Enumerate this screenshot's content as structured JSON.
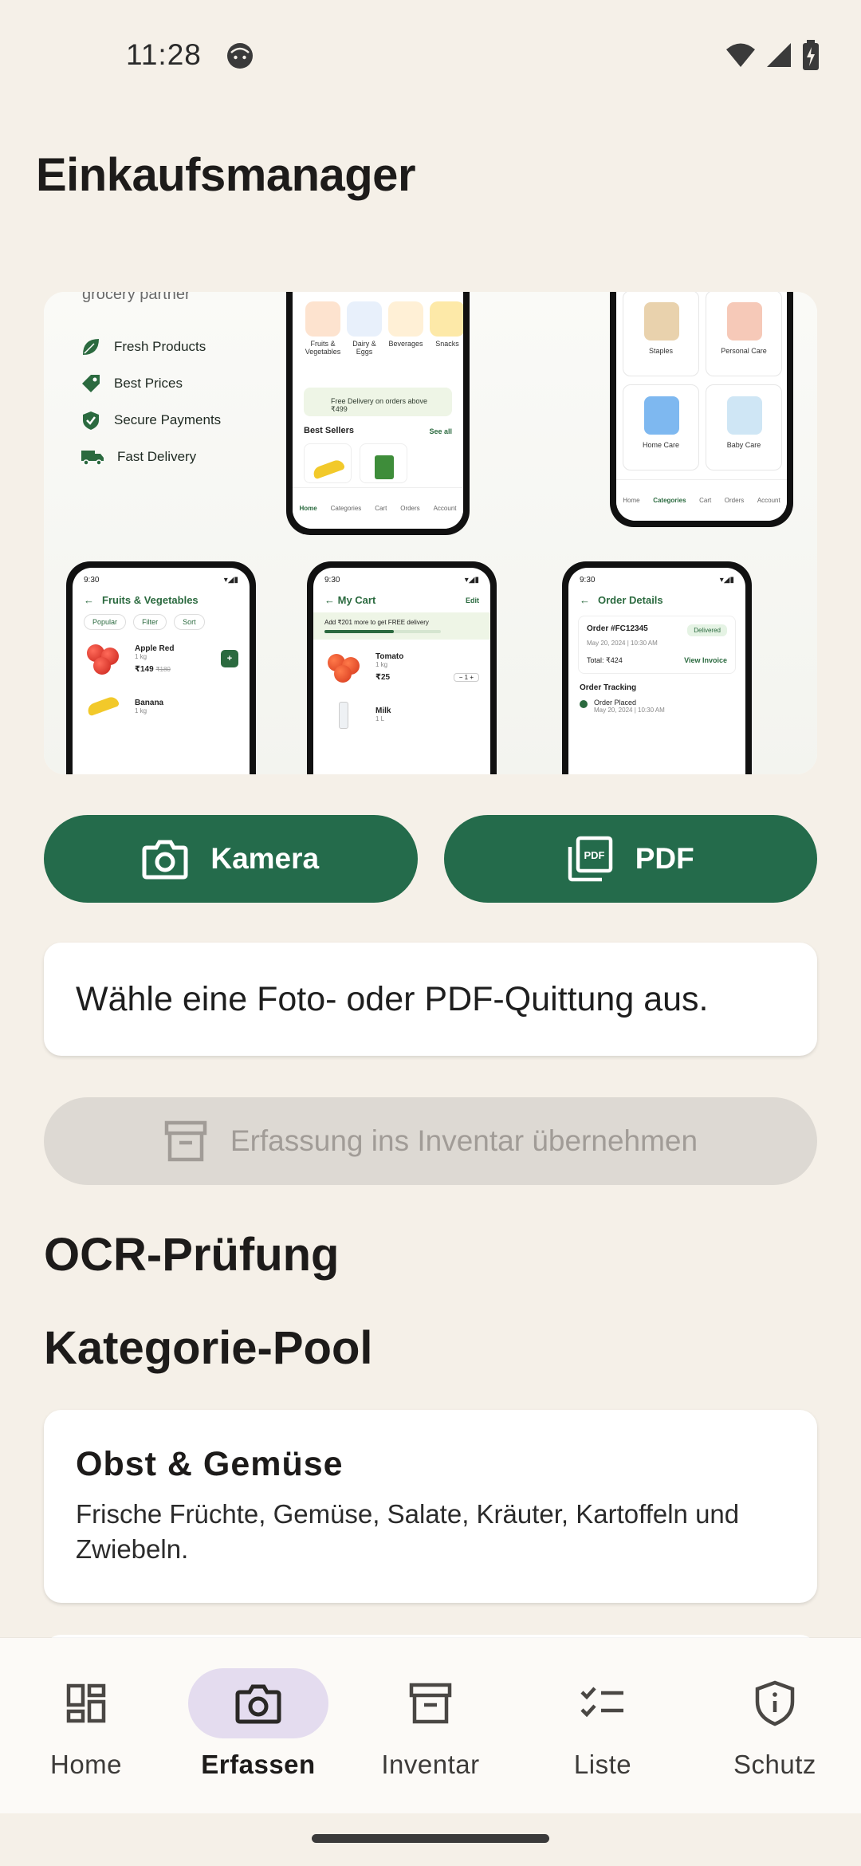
{
  "status": {
    "time": "11:28"
  },
  "app": {
    "title": "Einkaufsmanager"
  },
  "hero": {
    "partner_text": "grocery partner",
    "features": [
      "Fresh Products",
      "Best Prices",
      "Secure Payments",
      "Fast Delivery"
    ],
    "home_screen": {
      "categories": [
        "Fruits & Vegetables",
        "Dairy & Eggs",
        "Beverages",
        "Snacks"
      ],
      "promo": "Free Delivery on orders above ₹499",
      "best_sellers": "Best Sellers",
      "see_all": "See all",
      "nav": [
        "Home",
        "Categories",
        "Cart",
        "Orders",
        "Account"
      ]
    },
    "categories_screen": {
      "tiles": [
        "Staples",
        "Personal Care",
        "Home Care",
        "Baby Care"
      ],
      "nav": [
        "Home",
        "Categories",
        "Cart",
        "Orders",
        "Account"
      ]
    },
    "fruits_screen": {
      "time": "9:30",
      "title": "Fruits & Vegetables",
      "chips": [
        "Popular",
        "Filter",
        "Sort"
      ],
      "items": [
        {
          "name": "Apple Red",
          "qty": "1 kg",
          "price": "₹149",
          "old_price": "₹180"
        },
        {
          "name": "Banana",
          "qty": "1 kg"
        }
      ]
    },
    "cart_screen": {
      "time": "9:30",
      "title": "My Cart",
      "edit": "Edit",
      "promo": "Add ₹201 more to get FREE delivery",
      "items": [
        {
          "name": "Tomato",
          "qty": "1 kg",
          "price": "₹25",
          "count": "1"
        },
        {
          "name": "Milk",
          "qty": "1 L"
        }
      ]
    },
    "order_screen": {
      "time": "9:30",
      "title": "Order Details",
      "order_id": "Order #FC12345",
      "status": "Delivered",
      "date": "May 20, 2024 | 10:30 AM",
      "total": "Total: ₹424",
      "view_invoice": "View Invoice",
      "tracking": "Order Tracking",
      "placed": "Order Placed",
      "placed_date": "May 20, 2024 | 10:30 AM"
    }
  },
  "actions": {
    "camera_label": "Kamera",
    "pdf_label": "PDF",
    "info_text": "Wähle eine Foto- oder PDF-Quittung aus.",
    "commit_label": "Erfassung ins Inventar übernehmen"
  },
  "sections": {
    "ocr_title": "OCR-Prüfung",
    "pool_title": "Kategorie-Pool"
  },
  "category_card": {
    "title": "Obst & Gemüse",
    "description": "Frische Früchte, Gemüse, Salate, Kräuter, Kartoffeln und Zwiebeln."
  },
  "nav": {
    "items": [
      {
        "label": "Home",
        "icon": "dashboard-icon"
      },
      {
        "label": "Erfassen",
        "icon": "camera-icon",
        "active": true
      },
      {
        "label": "Inventar",
        "icon": "archive-icon"
      },
      {
        "label": "Liste",
        "icon": "checklist-icon"
      },
      {
        "label": "Schutz",
        "icon": "shield-info-icon"
      }
    ]
  },
  "colors": {
    "background": "#f5f0e8",
    "primary": "#246b4b",
    "nav_active": "#e4dcef",
    "disabled_bg": "#ddd9d3",
    "disabled_text": "#a19c97"
  }
}
